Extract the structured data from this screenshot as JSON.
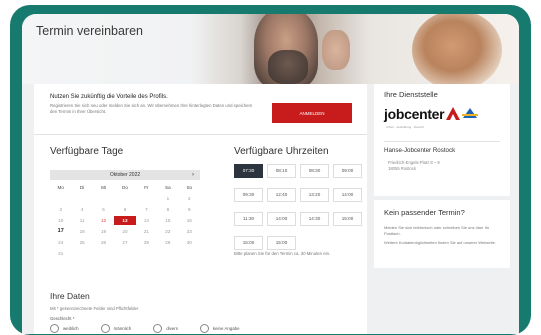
{
  "hero": {
    "title": "Termin vereinbaren"
  },
  "promo": {
    "title": "Nutzen Sie zukünftig die Vorteile des Profils.",
    "text": "Registrieren Sie sich neu oder melden Sie sich an. Wir übernehmen Ihre hinterlegten Daten und speichern den Termin in Ihrer Übersicht.",
    "button_label": "ANMELDEN"
  },
  "days": {
    "title": "Verfügbare Tage",
    "month": "Oktober 2022",
    "next_arrow": "›",
    "weekdays": [
      "Mo",
      "Di",
      "Mi",
      "Do",
      "Fr",
      "Sa",
      "So"
    ],
    "rows": [
      [
        "",
        "",
        "",
        "",
        "",
        "1",
        "2"
      ],
      [
        "3",
        "4",
        "5",
        "6",
        "7",
        "8",
        "9"
      ],
      [
        "10",
        "11",
        "12",
        "13",
        "14",
        "15",
        "16"
      ],
      [
        "17",
        "18",
        "19",
        "20",
        "21",
        "22",
        "23"
      ],
      [
        "24",
        "25",
        "26",
        "27",
        "28",
        "29",
        "30"
      ],
      [
        "31",
        "",
        "",
        "",
        "",
        "",
        ""
      ]
    ],
    "selected_day": "13",
    "today_day": "17",
    "highlight_days": [
      "12"
    ]
  },
  "times": {
    "title": "Verfügbare Uhrzeiten",
    "slots": [
      "07:30",
      "08:10",
      "08:30",
      "09:00",
      "09:30",
      "12:40",
      "13:20",
      "14:00",
      "11:30",
      "14:00",
      "14:30",
      "15:00",
      "15:00",
      "15:00"
    ],
    "selected_index": 0,
    "note": "Bitte planen Sie für den Termin ca. 30 Minuten ein."
  },
  "personal": {
    "title": "Ihre Daten",
    "hint": "Mit * gekennzeichnete Felder sind Pflichtfelder",
    "gender_label": "Geschlecht *",
    "gender_options": [
      "weiblich",
      "männlich",
      "divers",
      "keine Angabe"
    ]
  },
  "office": {
    "title": "Ihre Dienststelle",
    "logo_text": "jobcenter",
    "logo_sub": "Arbeit · Ausbildung · Zukunft",
    "name": "Hanse-Jobcenter Rostock",
    "address_line1": "Friedrich-Engels-Platz 8 – 9",
    "address_line2": "18055 Rostock"
  },
  "no_match": {
    "title": "Kein passender Termin?",
    "line1": "Melden Sie sich telefonisch oder schreiben Sie uns über Ihr Postfach.",
    "line2": "Weitere Kontaktmöglichkeiten finden Sie auf unserer Webseite."
  },
  "colors": {
    "frame": "#167a6f",
    "accent_red": "#c81c1c",
    "selected_slot": "#2c3440"
  }
}
